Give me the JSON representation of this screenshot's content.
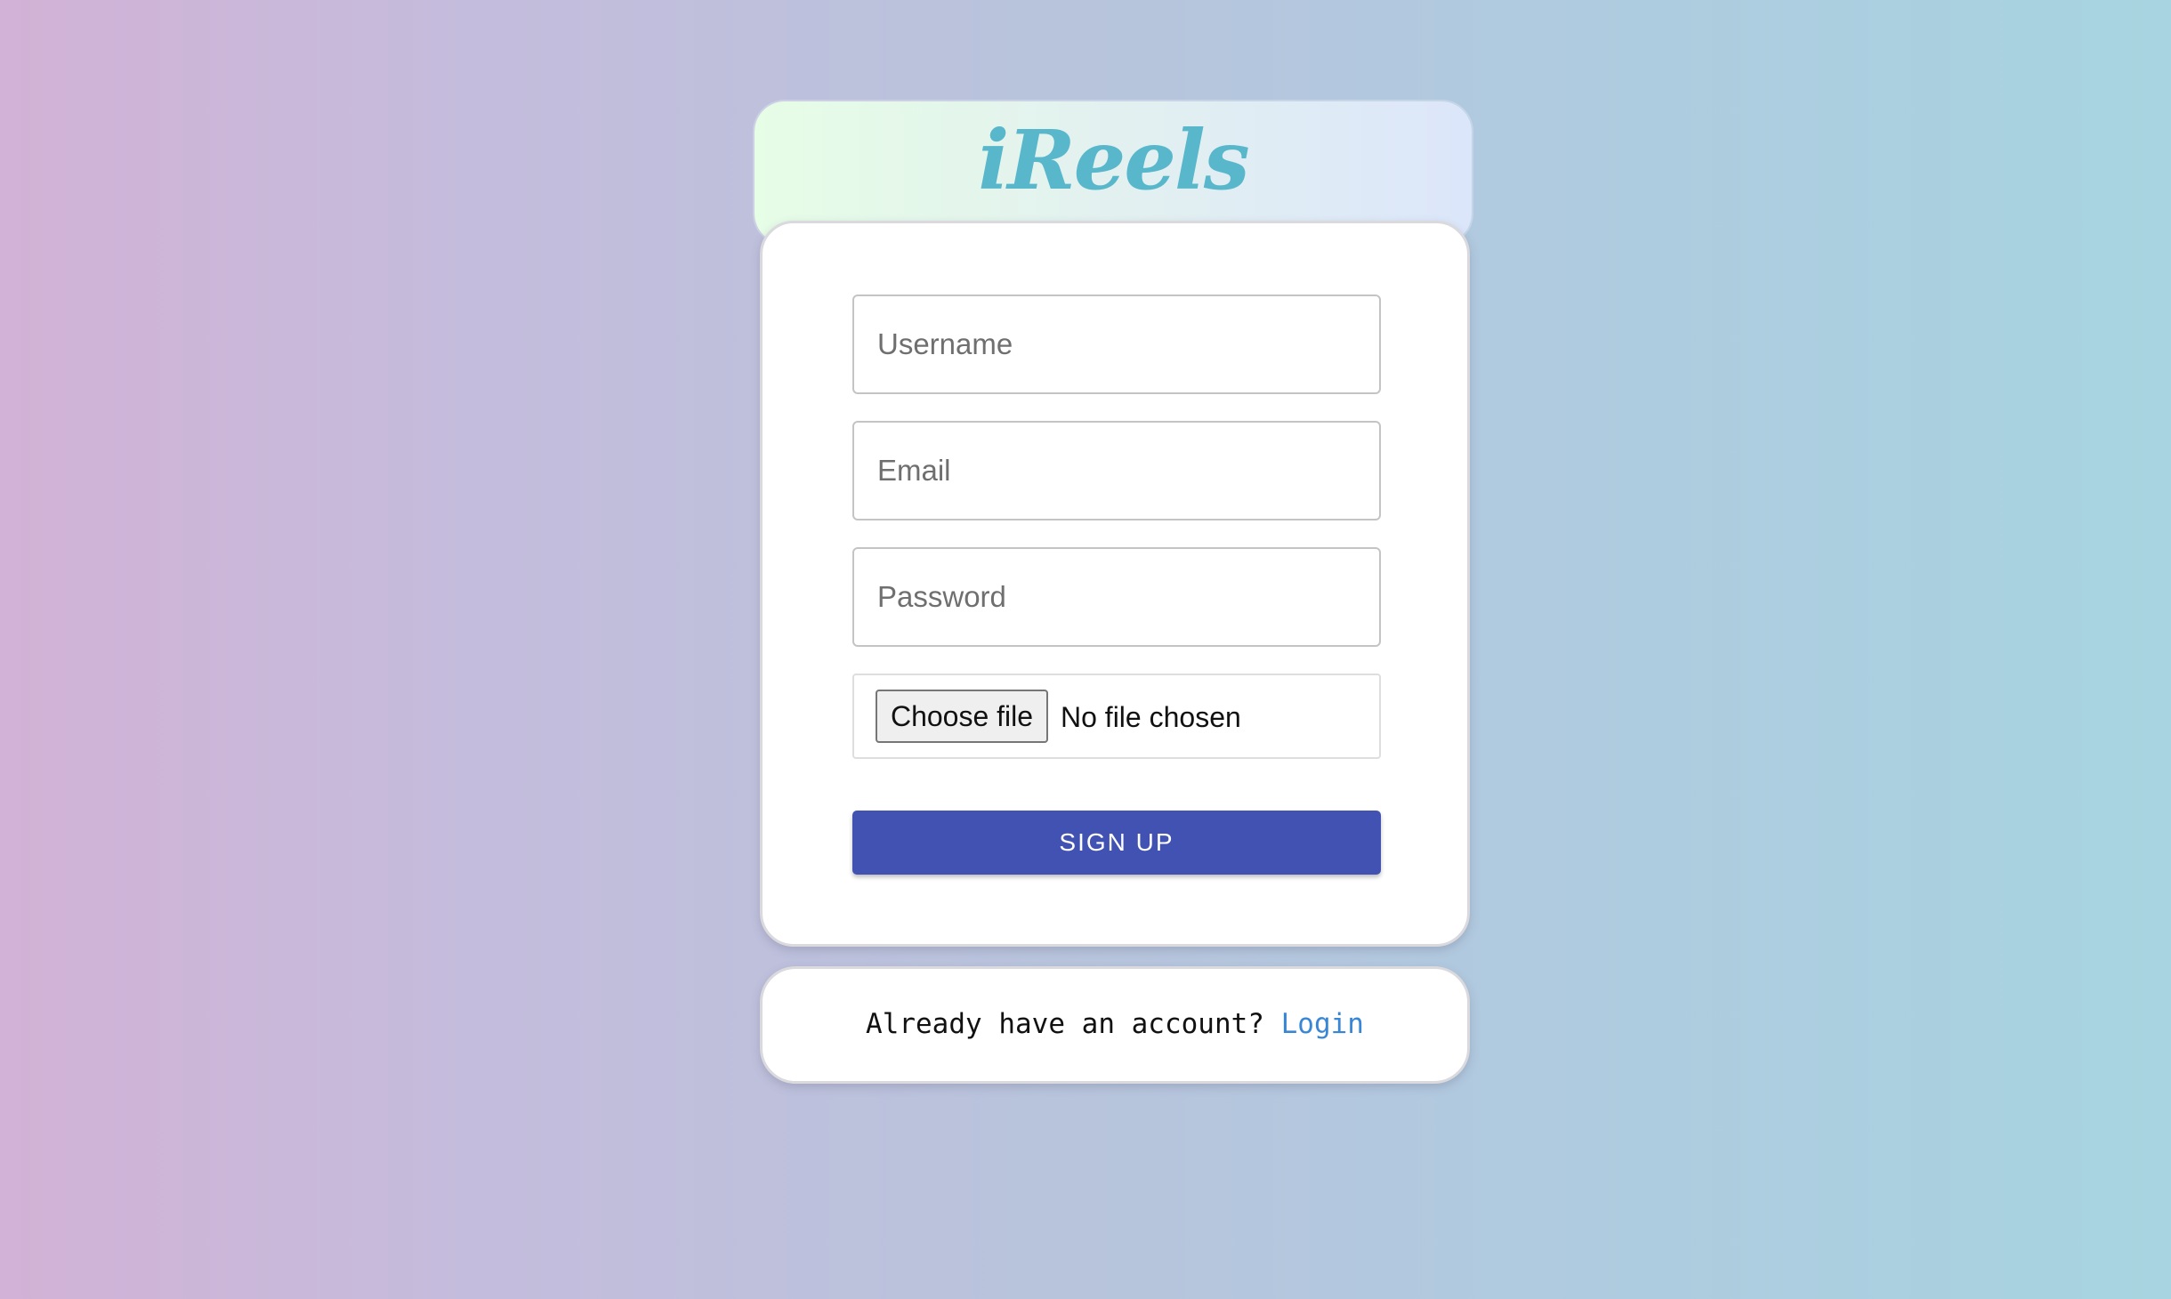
{
  "app": {
    "logo": "iReels"
  },
  "signup_form": {
    "username_placeholder": "Username",
    "email_placeholder": "Email",
    "password_placeholder": "Password",
    "file_button_label": "Choose file",
    "file_status": "No file chosen",
    "submit_label": "SIGN UP"
  },
  "login_prompt": {
    "text": "Already have an account?",
    "link_label": "Login"
  },
  "colors": {
    "logo": "#58b7cb",
    "button": "#4252b2",
    "link": "#3a86d6"
  }
}
